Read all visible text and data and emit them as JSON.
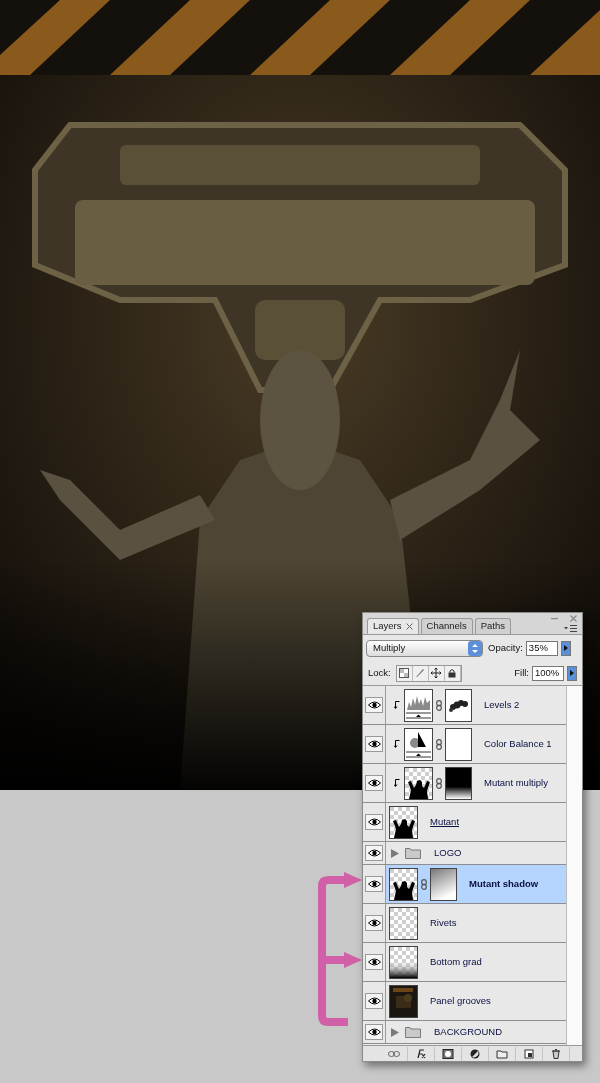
{
  "layers_panel": {
    "tabs": [
      {
        "label": "Layers",
        "selected": true,
        "closable": true
      },
      {
        "label": "Channels",
        "selected": false,
        "closable": false
      },
      {
        "label": "Paths",
        "selected": false,
        "closable": false
      }
    ],
    "blend_mode": "Multiply",
    "opacity_label": "Opacity:",
    "opacity": "35%",
    "lock_label": "Lock:",
    "fill_label": "Fill:",
    "fill": "100%",
    "layers": [
      {
        "name": "Levels 2",
        "kind": "layer",
        "thumb": {
          "kind": "levels"
        },
        "mask": {
          "kind": "blobs"
        },
        "clipped": true,
        "visible": true,
        "selected": false,
        "underlined": false
      },
      {
        "name": "Color Balance 1",
        "kind": "layer",
        "thumb": {
          "kind": "balance"
        },
        "mask": {
          "kind": "white"
        },
        "clipped": true,
        "visible": true,
        "selected": false,
        "underlined": false
      },
      {
        "name": "Mutant multiply",
        "kind": "layer",
        "thumb": {
          "kind": "figure"
        },
        "mask": {
          "kind": "fade"
        },
        "clipped": true,
        "visible": true,
        "selected": false,
        "underlined": false
      },
      {
        "name": "Mutant",
        "kind": "layer",
        "thumb": {
          "kind": "figure"
        },
        "clipped": false,
        "visible": true,
        "selected": false,
        "underlined": true
      },
      {
        "name": "LOGO",
        "kind": "group",
        "expanded": false,
        "visible": true,
        "selected": false
      },
      {
        "name": "Mutant shadow",
        "kind": "layer",
        "thumb": {
          "kind": "figure"
        },
        "mask": {
          "kind": "gradient"
        },
        "clipped": false,
        "visible": true,
        "selected": true,
        "underlined": false
      },
      {
        "name": "Rivets",
        "kind": "layer",
        "thumb": {
          "kind": "checker"
        },
        "clipped": false,
        "visible": true,
        "selected": false,
        "underlined": false
      },
      {
        "name": "Bottom grad",
        "kind": "layer",
        "thumb": {
          "kind": "gradient"
        },
        "clipped": false,
        "visible": true,
        "selected": false,
        "underlined": false
      },
      {
        "name": "Panel grooves",
        "kind": "layer",
        "thumb": {
          "kind": "texture"
        },
        "clipped": false,
        "visible": true,
        "selected": false,
        "underlined": false
      },
      {
        "name": "BACKGROUND",
        "kind": "group",
        "expanded": false,
        "visible": true,
        "selected": false
      }
    ]
  }
}
